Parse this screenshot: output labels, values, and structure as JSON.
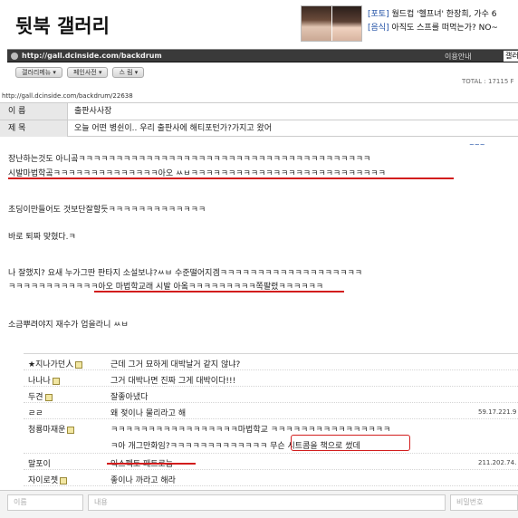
{
  "header": {
    "gallery_title": "뒷북 갤러리",
    "news": [
      {
        "category": "[포토]",
        "title": " 월드컵 '헬프녀' 한장희, 가수 6"
      },
      {
        "category": "[음식]",
        "title": " 아직도 스프를 떠먹는가? NO~"
      }
    ]
  },
  "url_bar": {
    "url": "http://gall.dcinside.com/backdrum",
    "help": "이용안내",
    "search_value": "갤러리"
  },
  "menu": {
    "tabs": [
      "갤러리메뉴 ▾",
      "페인사전 ▾",
      "스 림 ▾"
    ]
  },
  "stats": {
    "total": "TOTAL : 17115 F"
  },
  "post": {
    "url": "http://gall.dcinside.com/backdrum/22638",
    "name_label": "이 름",
    "name_value": "출판사사장",
    "subject_label": "제 목",
    "subject_value": "오늘 어떤 병쉰이.. 우리 출판사에 해티포턴가?가지고 왔어",
    "side_mark": "~~~",
    "lines": [
      "장난하는것도 아니곸ㅋㅋㅋㅋㅋㅋㅋㅋㅋㅋㅋㅋㅋㅋㅋㅋㅋㅋㅋㅋㅋㅋㅋㅋㅋㅋㅋㅋㅋㅋㅋㅋㅋㅋㅋㅋㅋㅋㅋ",
      "시발마법학곸ㅋㅋㅋㅋㅋㅋㅋㅋㅋㅋㅋㅋㅋㅋ아오 ㅆㅂㅋㅋㅋㅋㅋㅋㅋㅋㅋㅋㅋㅋㅋㅋㅋㅋㅋㅋㅋㅋㅋㅋㅋㅋㅋㅋ",
      "초딩이만들어도 것보단잘할듯ㅋㅋㅋㅋㅋㅋㅋㅋㅋㅋㅋㅋㅋ",
      "바로 퇴짜 맞혔다.ㅋ",
      "나 잘했지? 요새 누가그딴 판타지 소설보냐?ㅆㅂ 수준떨어지겜ㅋㅋㅋㅋㅋㅋㅋㅋㅋㅋㅋㅋㅋㅋㅋㅋㅋㅋㅋ",
      "ㅋㅋㅋㅋㅋㅋㅋㅋㅋㅋㅋㅋ아오 마법학교래 시발 아옼ㅋㅋㅋㅋㅋㅋㅋㅋㅋ쪽팔렸ㅋㅋㅋㅋㅋㅋ",
      "소금뿌려야지 재수가 업을라니 ㅆㅂ"
    ]
  },
  "comments": [
    {
      "name": "★지나가던人",
      "icon": true,
      "text": "근데 그거 묘하게 대박날거 같지 않냐?",
      "ip": ""
    },
    {
      "name": "나나나",
      "icon": true,
      "text": "그거 대박나면 진짜 그게 대박이다!!!",
      "ip": ""
    },
    {
      "name": "두견",
      "icon": true,
      "text": "잘좋아냈다",
      "ip": ""
    },
    {
      "name": "ㄹㄹ",
      "icon": false,
      "text": "왜 젖이나 물리라고 해",
      "ip": "59.17.221.9"
    },
    {
      "name": "청룡마재운",
      "icon": true,
      "text": "ㅋㅋㅋㅋㅋㅋㅋㅋㅋㅋㅋㅋㅋㅋㅋㅋㅋ마법학교 ㅋㅋㅋㅋㅋㅋㅋㅋㅋㅋㅋㅋㅋㅋㅋㅋ",
      "text2": "ㅋ아 개그만화임?ㅋㅋㅋㅋㅋㅋㅋㅋㅋㅋㅋㅋㅋ 무슨 시트콤을 책으로 썼데",
      "ip": ""
    },
    {
      "name": "말포이",
      "icon": false,
      "text": "익스펙토 패트로눔",
      "ip": "211.202.74."
    },
    {
      "name": "자이로젯",
      "icon": true,
      "text": "좋이나 까라고 해라",
      "ip": ""
    }
  ],
  "form": {
    "name_placeholder": "이름",
    "content_placeholder": "내용",
    "password_placeholder": "비밀번호"
  },
  "colors": {
    "highlight": "#d21d1d",
    "link": "#1f4fa5",
    "urlbar": "#3a3a3a"
  }
}
